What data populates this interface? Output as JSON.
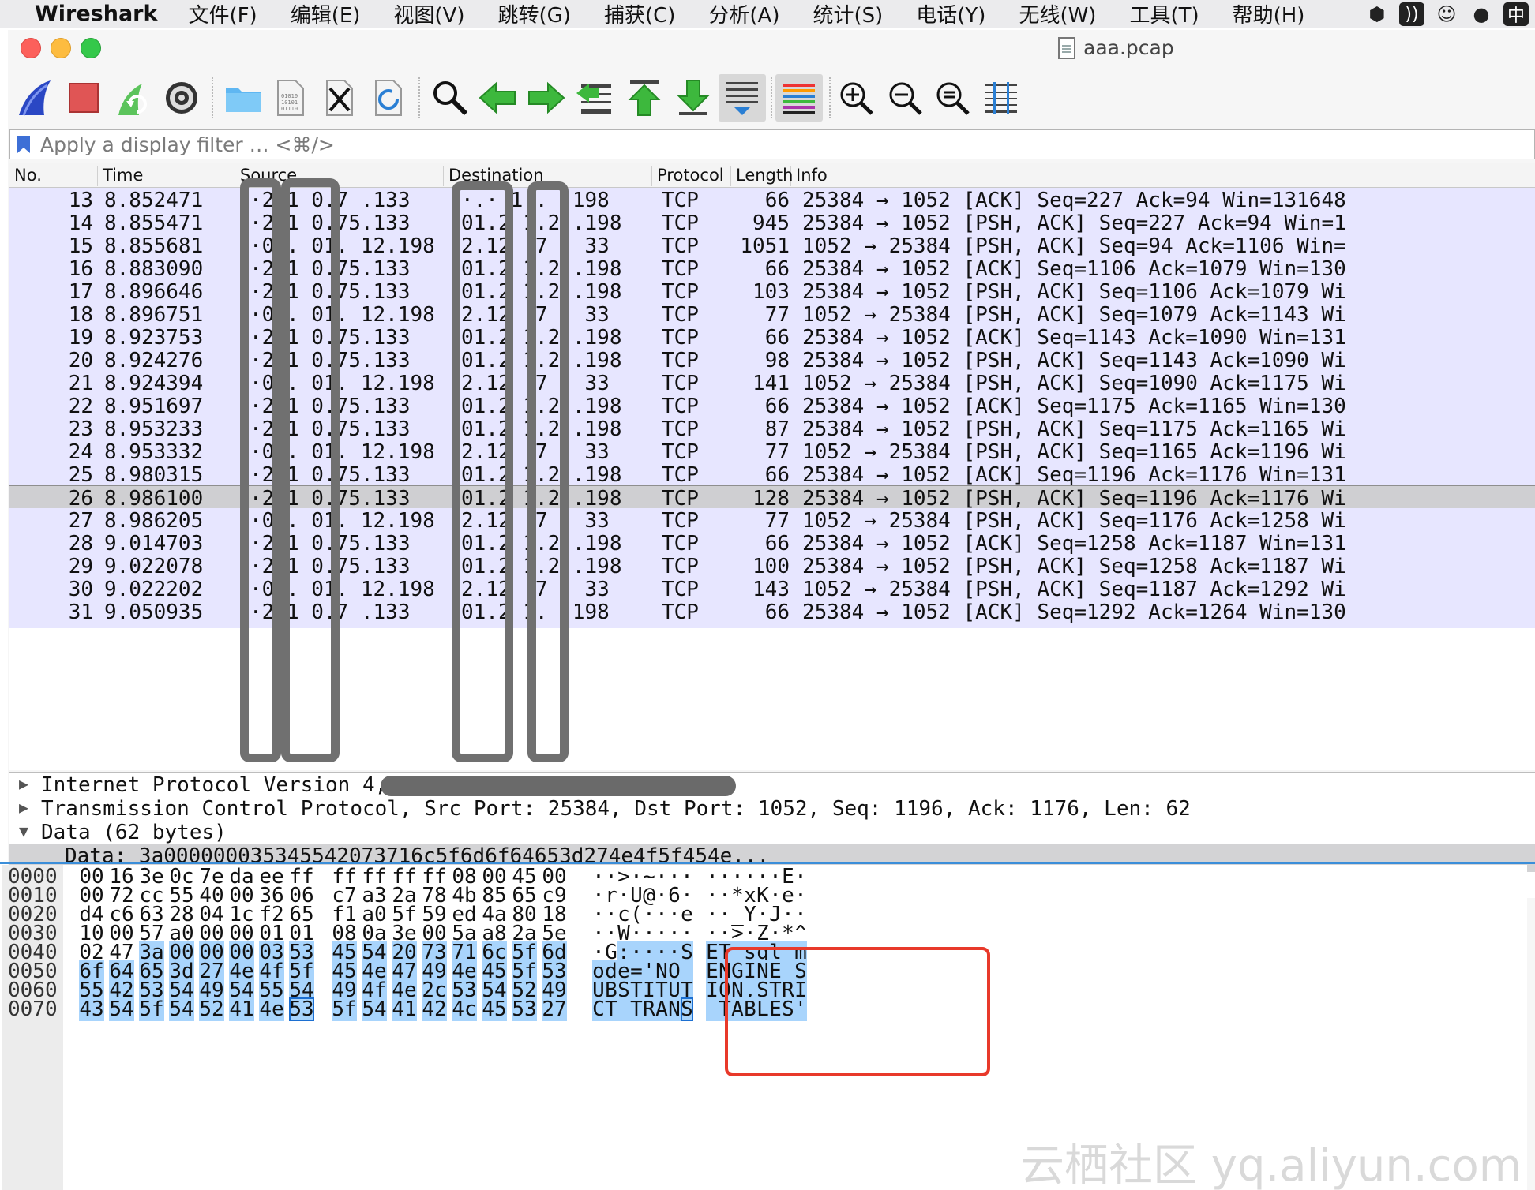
{
  "menubar": {
    "app": "Wireshark",
    "items": [
      "文件(F)",
      "编辑(E)",
      "视图(V)",
      "跳转(G)",
      "捕获(C)",
      "分析(A)",
      "统计(S)",
      "电话(Y)",
      "无线(W)",
      "工具(T)",
      "帮助(H)"
    ],
    "status_ime": "中"
  },
  "window": {
    "title": "aaa.pcap"
  },
  "toolbar": {
    "icons": [
      "shark-fin-icon",
      "stop-icon",
      "restart-icon",
      "gear-icon",
      "folder-icon",
      "file-icon",
      "close-file-icon",
      "reload-file-icon",
      "search-icon",
      "arrow-left-icon",
      "arrow-right-icon",
      "goto-icon",
      "first-icon",
      "last-icon",
      "autoscroll-icon",
      "colorize-icon",
      "zoom-in-icon",
      "zoom-out-icon",
      "zoom-reset-icon",
      "resize-columns-icon"
    ]
  },
  "filter": {
    "placeholder": "Apply a display filter … <⌘/>"
  },
  "packet_list": {
    "columns": [
      "No.",
      "Time",
      "Source",
      "Destination",
      "Protocol",
      "Length",
      "Info"
    ],
    "rows": [
      {
        "no": "13",
        "time": "8.852471",
        "src": "·2 1 0.7 .133",
        "dst": "·.· 1 . .198",
        "proto": "TCP",
        "len": "66",
        "info": "25384 → 1052 [ACK] Seq=227 Ack=94 Win=131648"
      },
      {
        "no": "14",
        "time": "8.855471",
        "src": "·2 1 0.75.133",
        "dst": "01.2 1.2 .198",
        "proto": "TCP",
        "len": "945",
        "info": "25384 → 1052 [PSH, ACK] Seq=227 Ack=94 Win=1"
      },
      {
        "no": "15",
        "time": "8.855681",
        "src": "·0 . 01. 12.198",
        "dst": "2.12 .7 . 33",
        "proto": "TCP",
        "len": "1051",
        "info": "1052 → 25384 [PSH, ACK] Seq=94 Ack=1106 Win="
      },
      {
        "no": "16",
        "time": "8.883090",
        "src": "·2 1 0.75.133",
        "dst": "01.2 1.2 .198",
        "proto": "TCP",
        "len": "66",
        "info": "25384 → 1052 [ACK] Seq=1106 Ack=1079 Win=130"
      },
      {
        "no": "17",
        "time": "8.896646",
        "src": "·2 1 0.75.133",
        "dst": "01.2 1.2 .198",
        "proto": "TCP",
        "len": "103",
        "info": "25384 → 1052 [PSH, ACK] Seq=1106 Ack=1079 Wi"
      },
      {
        "no": "18",
        "time": "8.896751",
        "src": "·0 . 01. 12.198",
        "dst": "2.12 .7 . 33",
        "proto": "TCP",
        "len": "77",
        "info": "1052 → 25384 [PSH, ACK] Seq=1079 Ack=1143 Wi"
      },
      {
        "no": "19",
        "time": "8.923753",
        "src": "·2 1 0.75.133",
        "dst": "01.2 1.2 .198",
        "proto": "TCP",
        "len": "66",
        "info": "25384 → 1052 [ACK] Seq=1143 Ack=1090 Win=131"
      },
      {
        "no": "20",
        "time": "8.924276",
        "src": "·2 1 0.75.133",
        "dst": "01.2 1.2 .198",
        "proto": "TCP",
        "len": "98",
        "info": "25384 → 1052 [PSH, ACK] Seq=1143 Ack=1090 Wi"
      },
      {
        "no": "21",
        "time": "8.924394",
        "src": "·0 . 01. 12.198",
        "dst": "2.12 .7 . 33",
        "proto": "TCP",
        "len": "141",
        "info": "1052 → 25384 [PSH, ACK] Seq=1090 Ack=1175 Wi"
      },
      {
        "no": "22",
        "time": "8.951697",
        "src": "·2 1 0.75.133",
        "dst": "01.2 1.2 .198",
        "proto": "TCP",
        "len": "66",
        "info": "25384 → 1052 [ACK] Seq=1175 Ack=1165 Win=130"
      },
      {
        "no": "23",
        "time": "8.953233",
        "src": "·2 1 0.75.133",
        "dst": "01.2 1.2 .198",
        "proto": "TCP",
        "len": "87",
        "info": "25384 → 1052 [PSH, ACK] Seq=1175 Ack=1165 Wi"
      },
      {
        "no": "24",
        "time": "8.953332",
        "src": "·0 . 01. 12.198",
        "dst": "2.12 .7 . 33",
        "proto": "TCP",
        "len": "77",
        "info": "1052 → 25384 [PSH, ACK] Seq=1165 Ack=1196 Wi"
      },
      {
        "no": "25",
        "time": "8.980315",
        "src": "·2 1 0.75.133",
        "dst": "01.2 1.2 .198",
        "proto": "TCP",
        "len": "66",
        "info": "25384 → 1052 [ACK] Seq=1196 Ack=1176 Win=131"
      },
      {
        "no": "26",
        "time": "8.986100",
        "src": "·2 1 0.75.133",
        "dst": "01.2 1.2 .198",
        "proto": "TCP",
        "len": "128",
        "info": "25384 → 1052 [PSH, ACK] Seq=1196 Ack=1176 Wi"
      },
      {
        "no": "27",
        "time": "8.986205",
        "src": "·0 . 01. 12.198",
        "dst": "2.12 .7 . 33",
        "proto": "TCP",
        "len": "77",
        "info": "1052 → 25384 [PSH, ACK] Seq=1176 Ack=1258 Wi"
      },
      {
        "no": "28",
        "time": "9.014703",
        "src": "·2 1 0.75.133",
        "dst": "01.2 1.2 .198",
        "proto": "TCP",
        "len": "66",
        "info": "25384 → 1052 [ACK] Seq=1258 Ack=1187 Win=131"
      },
      {
        "no": "29",
        "time": "9.022078",
        "src": "·2 1 0.75.133",
        "dst": "01.2 1.2 .198",
        "proto": "TCP",
        "len": "100",
        "info": "25384 → 1052 [PSH, ACK] Seq=1258 Ack=1187 Wi"
      },
      {
        "no": "30",
        "time": "9.022202",
        "src": "·0 . 01. 12.198",
        "dst": "2.12 .7 . 33",
        "proto": "TCP",
        "len": "143",
        "info": "1052 → 25384 [PSH, ACK] Seq=1187 Ack=1292 Wi"
      },
      {
        "no": "31",
        "time": "9.050935",
        "src": "·2 1 0.7 .133",
        "dst": "01.2 1. .198",
        "proto": "TCP",
        "len": "66",
        "info": "25384 → 1052 [ACK] Seq=1292 Ack=1264 Win=130"
      }
    ],
    "selected_no": "26"
  },
  "details": {
    "rows": [
      {
        "arrow": "▶",
        "text": "Internet Protocol Version 4, Src:"
      },
      {
        "arrow": "▶",
        "text": "Transmission Control Protocol, Src Port: 25384, Dst Port: 1052, Seq: 1196, Ack: 1176, Len: 62"
      },
      {
        "arrow": "▼",
        "text": "Data (62 bytes)"
      },
      {
        "arrow": "",
        "text": "Data: 3a000000035345542073716c5f6d6f64653d274e4f5f454e..."
      }
    ]
  },
  "bytes": {
    "rows": [
      {
        "offset": "0000",
        "hex": [
          "00",
          "16",
          "3e",
          "0c",
          "7e",
          "da",
          "ee",
          "ff",
          "ff",
          "ff",
          "ff",
          "ff",
          "08",
          "00",
          "45",
          "00"
        ],
        "ascii": [
          "·",
          "·",
          ">",
          "·",
          "~",
          "·",
          "·",
          "·",
          "·",
          "·",
          "·",
          "·",
          "·",
          "·",
          "E",
          "·"
        ]
      },
      {
        "offset": "0010",
        "hex": [
          "00",
          "72",
          "cc",
          "55",
          "40",
          "00",
          "36",
          "06",
          "c7",
          "a3",
          "2a",
          "78",
          "4b",
          "85",
          "65",
          "c9"
        ],
        "ascii": [
          "·",
          "r",
          "·",
          "U",
          "@",
          "·",
          "6",
          "·",
          "·",
          "·",
          "*",
          "x",
          "K",
          "·",
          "e",
          "·"
        ]
      },
      {
        "offset": "0020",
        "hex": [
          "d4",
          "c6",
          "63",
          "28",
          "04",
          "1c",
          "f2",
          "65",
          "f1",
          "a0",
          "5f",
          "59",
          "ed",
          "4a",
          "80",
          "18"
        ],
        "ascii": [
          "·",
          "·",
          "c",
          "(",
          "·",
          "·",
          "·",
          "e",
          "·",
          "·",
          "_",
          "Y",
          "·",
          "J",
          "·",
          "·"
        ]
      },
      {
        "offset": "0030",
        "hex": [
          "10",
          "00",
          "57",
          "a0",
          "00",
          "00",
          "01",
          "01",
          "08",
          "0a",
          "3e",
          "00",
          "5a",
          "a8",
          "2a",
          "5e"
        ],
        "ascii": [
          "·",
          "·",
          "W",
          "·",
          "·",
          "·",
          "·",
          "·",
          "·",
          "·",
          ">",
          "·",
          "Z",
          "·",
          "*",
          "^"
        ]
      },
      {
        "offset": "0040",
        "hex": [
          "02",
          "47",
          "3a",
          "00",
          "00",
          "00",
          "03",
          "53",
          "45",
          "54",
          "20",
          "73",
          "71",
          "6c",
          "5f",
          "6d"
        ],
        "ascii": [
          "·",
          "G",
          ":",
          "·",
          "·",
          "·",
          "·",
          "S",
          "E",
          "T",
          " ",
          "s",
          "q",
          "l",
          "_",
          "m"
        ]
      },
      {
        "offset": "0050",
        "hex": [
          "6f",
          "64",
          "65",
          "3d",
          "27",
          "4e",
          "4f",
          "5f",
          "45",
          "4e",
          "47",
          "49",
          "4e",
          "45",
          "5f",
          "53"
        ],
        "ascii": [
          "o",
          "d",
          "e",
          "=",
          "'",
          "N",
          "O",
          "_",
          "E",
          "N",
          "G",
          "I",
          "N",
          "E",
          "_",
          "S"
        ]
      },
      {
        "offset": "0060",
        "hex": [
          "55",
          "42",
          "53",
          "54",
          "49",
          "54",
          "55",
          "54",
          "49",
          "4f",
          "4e",
          "2c",
          "53",
          "54",
          "52",
          "49"
        ],
        "ascii": [
          "U",
          "B",
          "S",
          "T",
          "I",
          "T",
          "U",
          "T",
          "I",
          "O",
          "N",
          ",",
          "S",
          "T",
          "R",
          "I"
        ]
      },
      {
        "offset": "0070",
        "hex": [
          "43",
          "54",
          "5f",
          "54",
          "52",
          "41",
          "4e",
          "53",
          "5f",
          "54",
          "41",
          "42",
          "4c",
          "45",
          "53",
          "27"
        ],
        "ascii": [
          "C",
          "T",
          "_",
          "T",
          "R",
          "A",
          "N",
          "S",
          "_",
          "T",
          "A",
          "B",
          "L",
          "E",
          "S",
          "'"
        ]
      }
    ]
  },
  "watermark": "云栖社区 yq.aliyun.com",
  "colors": {
    "row_bg": "#e7e6ff",
    "selected_row_bg": "#cfcfd2",
    "byte_highlight": "#a8d4fc",
    "annotation_red": "#e8392a"
  }
}
